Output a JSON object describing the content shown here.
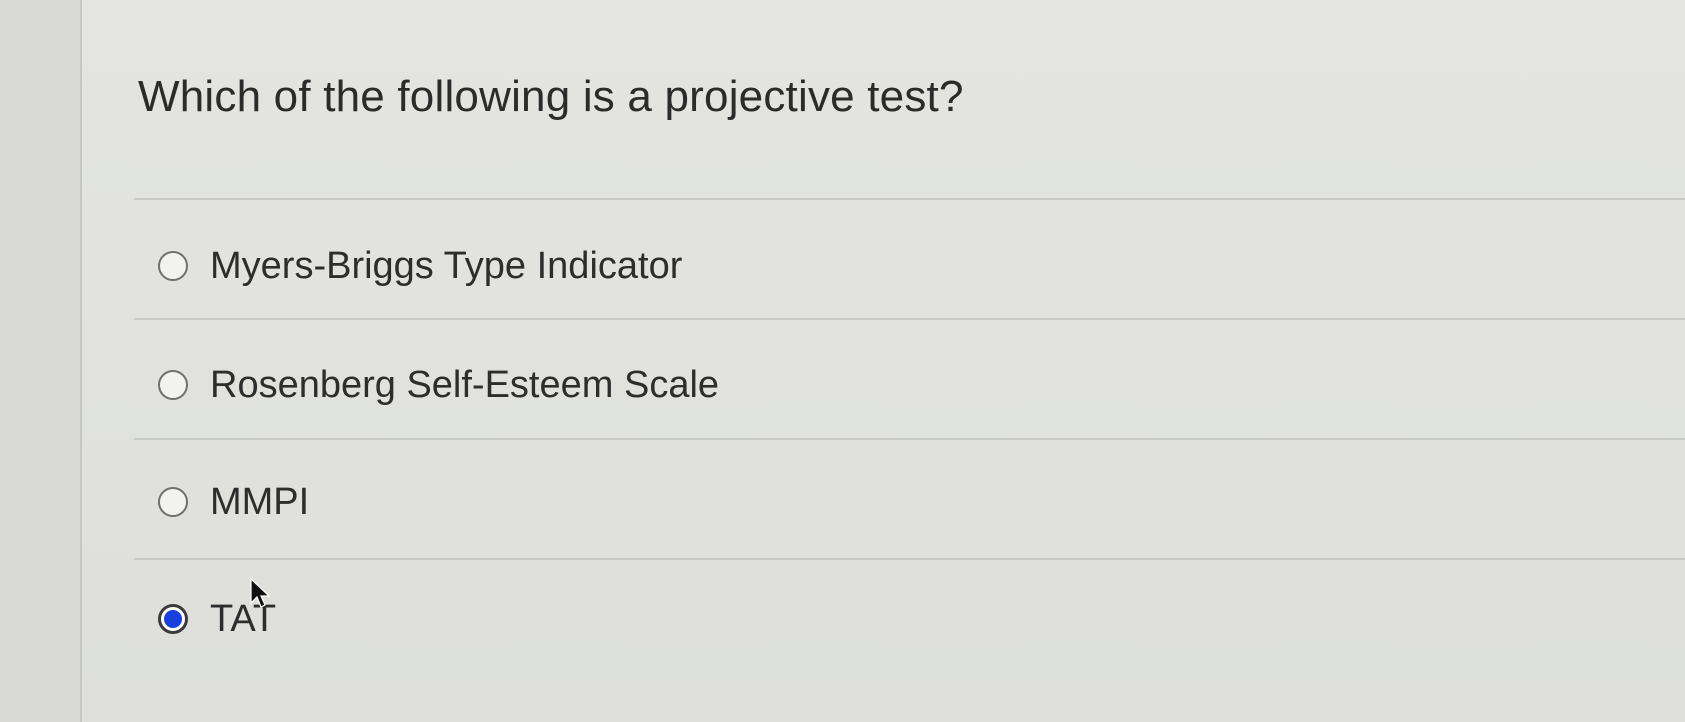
{
  "question": {
    "text": "Which of the following is a projective test?"
  },
  "options": [
    {
      "label": "Myers-Briggs Type Indicator",
      "selected": false
    },
    {
      "label": "Rosenberg Self-Esteem Scale",
      "selected": false
    },
    {
      "label": "MMPI",
      "selected": false
    },
    {
      "label": "TAT",
      "selected": true
    }
  ],
  "colors": {
    "selected_radio": "#1a3fe0",
    "text": "#2d2d2d"
  }
}
